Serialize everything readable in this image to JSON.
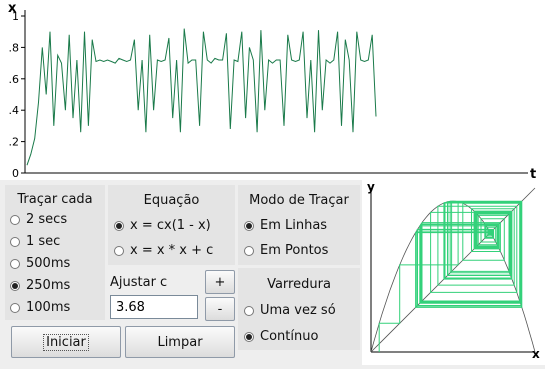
{
  "plot": {
    "axis_x_label": "x",
    "axis_t_label": "t",
    "y_ticks": [
      "1",
      ".8",
      ".6",
      ".4",
      ".2",
      "0"
    ],
    "series_color": "#1a7a4a",
    "series": [
      0.05,
      0.12,
      0.22,
      0.45,
      0.8,
      0.5,
      0.9,
      0.3,
      0.75,
      0.7,
      0.4,
      0.88,
      0.35,
      0.72,
      0.26,
      0.9,
      0.3,
      0.85,
      0.71,
      0.72,
      0.71,
      0.72,
      0.71,
      0.7,
      0.73,
      0.72,
      0.71,
      0.72,
      0.85,
      0.4,
      0.72,
      0.26,
      0.88,
      0.4,
      0.72,
      0.71,
      0.72,
      0.86,
      0.35,
      0.72,
      0.26,
      0.92,
      0.7,
      0.72,
      0.72,
      0.3,
      0.9,
      0.72,
      0.7,
      0.73,
      0.72,
      0.72,
      0.89,
      0.28,
      0.72,
      0.71,
      0.9,
      0.35,
      0.8,
      0.72,
      0.26,
      0.91,
      0.4,
      0.72,
      0.7,
      0.72,
      0.72,
      0.3,
      0.88,
      0.72,
      0.71,
      0.72,
      0.9,
      0.35,
      0.72,
      0.26,
      0.91,
      0.4,
      0.72,
      0.7,
      0.72,
      0.9,
      0.3,
      0.85,
      0.72,
      0.26,
      0.9,
      0.72,
      0.71,
      0.72,
      0.88,
      0.36
    ]
  },
  "tracar": {
    "title": "Traçar cada",
    "options": [
      "2 secs",
      "1 sec",
      "500ms",
      "250ms",
      "100ms"
    ],
    "selected_index": 3
  },
  "equacao": {
    "title": "Equação",
    "options": [
      "x = cx(1 - x)",
      "x = x * x + c"
    ],
    "selected_index": 0
  },
  "modo": {
    "title": "Modo de Traçar",
    "options": [
      "Em Linhas",
      "Em Pontos"
    ],
    "selected_index": 0
  },
  "ajustar": {
    "label": "Ajustar c",
    "value": "3.68",
    "plus": "+",
    "minus": "-"
  },
  "varredura": {
    "title": "Varredura",
    "options": [
      "Uma vez só",
      "Contínuo"
    ],
    "selected_index": 1
  },
  "buttons": {
    "iniciar": "Iniciar",
    "limpar": "Limpar"
  },
  "cobweb": {
    "axis_y_label": "y",
    "axis_x_label": "x",
    "c": 3.68,
    "line_color": "#33d17a"
  }
}
